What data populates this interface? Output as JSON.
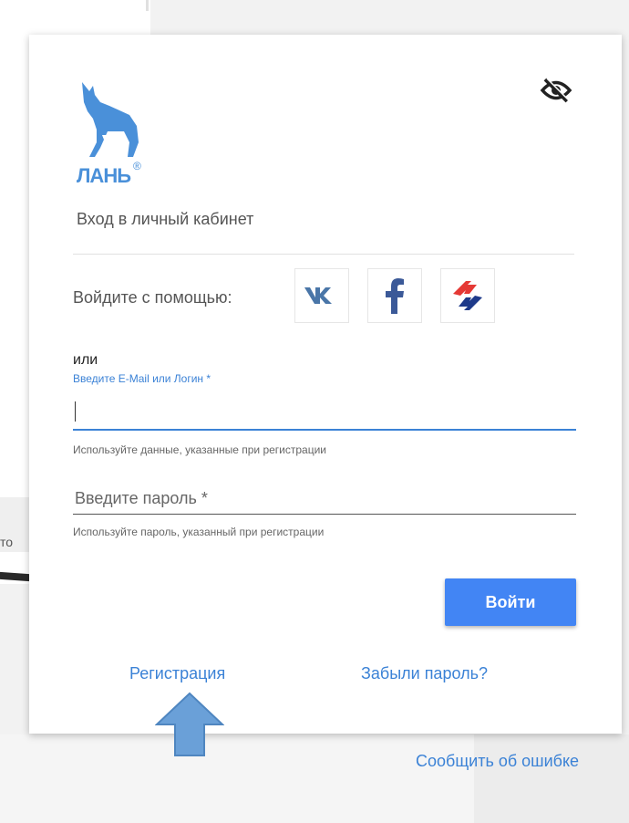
{
  "background": {
    "side_text": "то",
    "report_link": "Сообщить об ошибке"
  },
  "logo": {
    "text": "ЛАНЬ",
    "registered": "®"
  },
  "icons": {
    "visibility": "eye-off-icon",
    "vk": "vk-icon",
    "facebook": "facebook-icon",
    "esia": "arrows-swap-icon",
    "annotation": "up-arrow-icon"
  },
  "login": {
    "title": "Вход в личный кабинет",
    "social_label": "Войдите с помощью:",
    "or_text": "или",
    "email_label": "Введите E-Mail или Логин *",
    "email_value": "",
    "email_hint": "Используйте данные, указанные при регистрации",
    "password_placeholder": "Введите пароль *",
    "password_hint": "Используйте пароль, указанный при регистрации",
    "submit_label": "Войти",
    "register_link": "Регистрация",
    "forgot_link": "Забыли пароль?"
  },
  "colors": {
    "accent": "#4285f4",
    "link": "#3b82d6",
    "logo": "#4a90d9",
    "arrow": "#6aa0d8"
  }
}
